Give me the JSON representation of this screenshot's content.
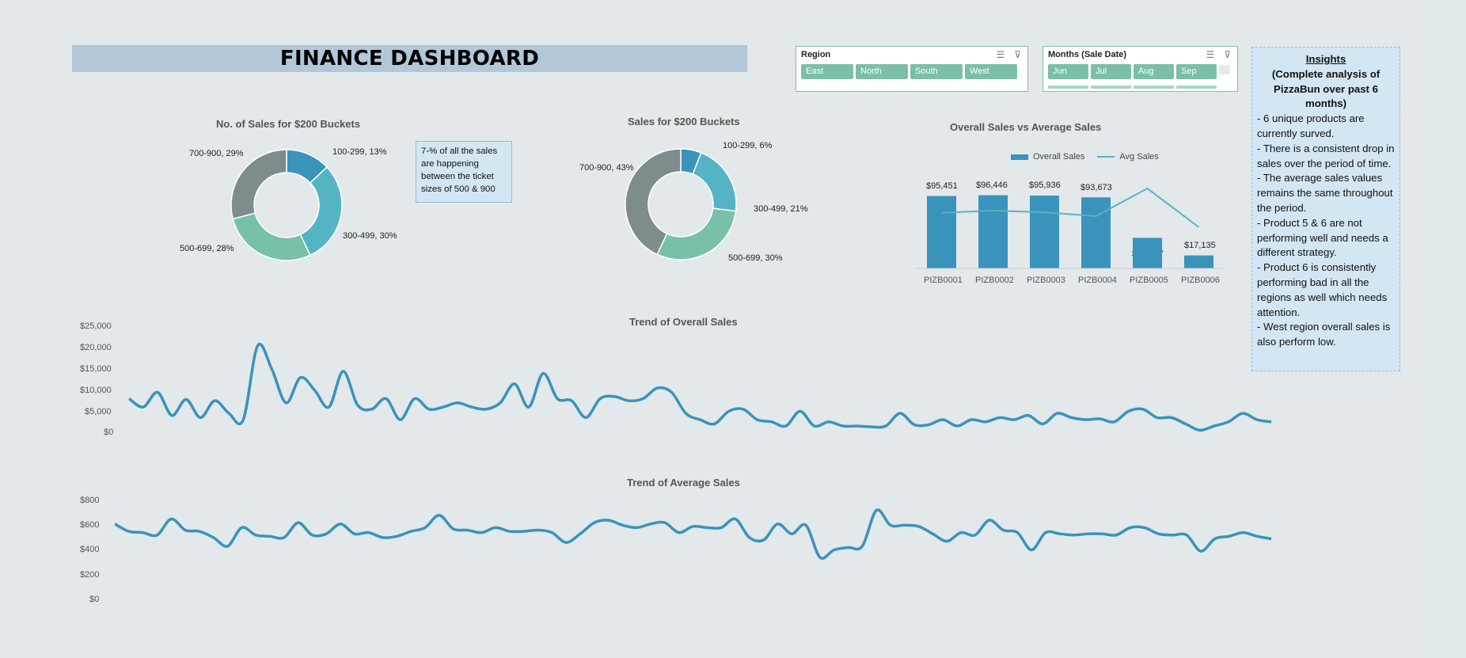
{
  "title": "FINANCE DASHBOARD",
  "region_slicer": {
    "title": "Region",
    "items": [
      "East",
      "North",
      "South",
      "West"
    ]
  },
  "months_slicer": {
    "title": "Months (Sale Date)",
    "items": [
      "Jun",
      "Jul",
      "Aug",
      "Sep"
    ]
  },
  "note": "7-% of all the sales are happening between the ticket sizes of 500 & 900",
  "insights": {
    "title": "Insights",
    "subtitle": "(Complete analysis of PizzaBun over past 6 months)",
    "points": [
      "- 6 unique products are currently surved.",
      "- There is a consistent drop in sales over the period of time.",
      "- The average sales values remains the same throughout the period.",
      "- Product 5 & 6 are not performing well and needs a different strategy.",
      "- Product 6 is consistently performing bad in all the regions as well which needs attention.",
      "- West region overall sales is also perform low."
    ]
  },
  "colors": {
    "teal_blue": "#3a93bb",
    "aqua": "#55b4c4",
    "mint": "#79c0a8",
    "slate": "#7f8c8d",
    "line": "#3a93bb"
  },
  "chart_data": [
    {
      "type": "pie",
      "title": "No. of Sales for $200 Buckets",
      "categories": [
        "100-299",
        "300-499",
        "500-699",
        "700-900"
      ],
      "values": [
        13,
        30,
        28,
        29
      ],
      "labels": [
        "100-299, 13%",
        "300-499, 30%",
        "500-699, 28%",
        "700-900, 29%"
      ]
    },
    {
      "type": "pie",
      "title": "Sales for $200 Buckets",
      "categories": [
        "100-299",
        "300-499",
        "500-699",
        "700-900"
      ],
      "values": [
        6,
        21,
        30,
        43
      ],
      "labels": [
        "100-299, 6%",
        "300-499, 21%",
        "500-699, 30%",
        "700-900, 43%"
      ]
    },
    {
      "type": "bar",
      "title": "Overall Sales vs Average Sales",
      "categories": [
        "PIZB0001",
        "PIZB0002",
        "PIZB0003",
        "PIZB0004",
        "PIZB0005",
        "PIZB0006"
      ],
      "series": [
        {
          "name": "Overall Sales",
          "values": [
            95451,
            96446,
            95936,
            93673,
            40327,
            17135
          ],
          "labels": [
            "$95,451",
            "$96,446",
            "$95,936",
            "$93,673",
            "$40,327",
            "$17,135"
          ]
        },
        {
          "name": "Avg Sales",
          "values": [
            0.56,
            0.6,
            0.57,
            0.5,
            1.0,
            0.3
          ]
        }
      ],
      "ylim": [
        0,
        120000
      ],
      "legend": "top"
    },
    {
      "type": "line",
      "title": "Trend of Overall Sales",
      "y_ticks": [
        "$25,000",
        "$20,000",
        "$15,000",
        "$10,000",
        "$5,000",
        "$0"
      ],
      "ylim": [
        0,
        25000
      ],
      "values": [
        8000,
        6000,
        9500,
        4000,
        7800,
        3500,
        7500,
        4500,
        3000,
        20500,
        15000,
        7000,
        13000,
        10000,
        6000,
        14500,
        6500,
        5500,
        8000,
        3000,
        8000,
        5500,
        6000,
        7000,
        6000,
        5500,
        7000,
        11500,
        6000,
        14000,
        8000,
        7500,
        3500,
        8000,
        8500,
        7500,
        8000,
        10500,
        9500,
        4500,
        3000,
        2000,
        5000,
        5500,
        3000,
        2500,
        1500,
        5000,
        1500,
        2500,
        1500,
        1500,
        1300,
        1500,
        4500,
        1800,
        1800,
        3000,
        1500,
        3000,
        2500,
        3500,
        3000,
        4000,
        2000,
        4500,
        3500,
        3000,
        3200,
        2500,
        5000,
        5500,
        3500,
        3500,
        2000,
        500,
        1500,
        2500,
        4500,
        3000,
        2500
      ]
    },
    {
      "type": "line",
      "title": "Trend of Average Sales",
      "y_ticks": [
        "$800",
        "$600",
        "$400",
        "$200",
        "$0"
      ],
      "ylim": [
        0,
        800
      ],
      "values": [
        610,
        550,
        540,
        520,
        650,
        560,
        550,
        500,
        430,
        580,
        520,
        510,
        500,
        620,
        520,
        530,
        610,
        530,
        540,
        500,
        510,
        550,
        580,
        680,
        570,
        560,
        540,
        580,
        550,
        550,
        560,
        540,
        460,
        530,
        620,
        640,
        600,
        580,
        610,
        620,
        540,
        590,
        580,
        580,
        650,
        500,
        480,
        610,
        530,
        600,
        340,
        400,
        420,
        430,
        720,
        600,
        600,
        590,
        530,
        470,
        540,
        520,
        640,
        560,
        540,
        400,
        540,
        530,
        520,
        530,
        530,
        520,
        580,
        580,
        530,
        520,
        520,
        390,
        490,
        510,
        540,
        510,
        490
      ]
    }
  ]
}
